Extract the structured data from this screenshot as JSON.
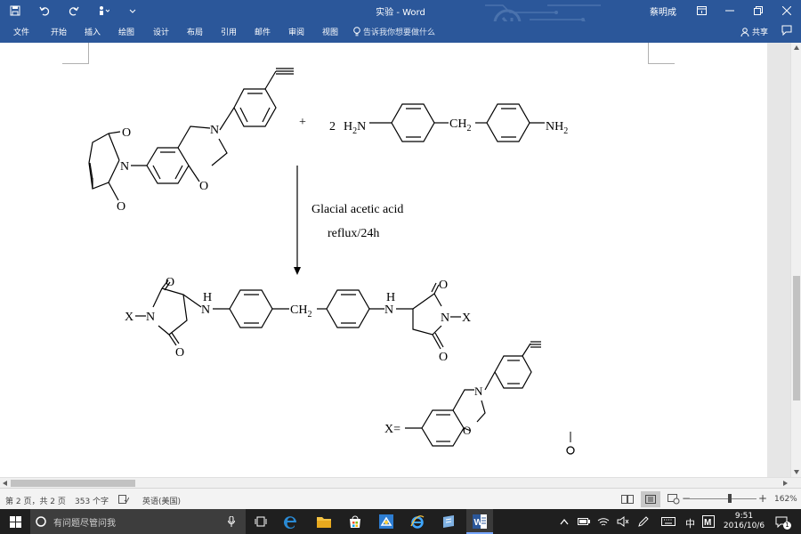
{
  "window": {
    "title": "实验 - Word",
    "user": "蔡明成"
  },
  "ribbon": {
    "tabs": [
      "文件",
      "开始",
      "插入",
      "绘图",
      "设计",
      "布局",
      "引用",
      "邮件",
      "审阅",
      "视图"
    ],
    "tell_me": "告诉我你想要做什么",
    "share": "共享"
  },
  "document": {
    "plus": "+",
    "coef": "2",
    "h2n": "H",
    "h2n_sub": "2",
    "h2n_n": "N",
    "nh2": "NH",
    "nh2_sub": "2",
    "ch2": "CH",
    "ch2_sub": "2",
    "reagent": "Glacial acetic acid",
    "condition": "reflux/24h",
    "atom_O": "O",
    "atom_N": "N",
    "atom_H": "H",
    "x_label": "X",
    "x_def": "X="
  },
  "status": {
    "page": "第 2 页，共 2 页",
    "words": "353 个字",
    "language": "英语(美国)",
    "zoom": "162%",
    "zoom_minus": "−",
    "zoom_plus": "+"
  },
  "taskbar": {
    "search_placeholder": "有问题尽管问我",
    "ime": "中",
    "time": "9:51",
    "date": "2016/10/6",
    "notif_count": "1"
  }
}
